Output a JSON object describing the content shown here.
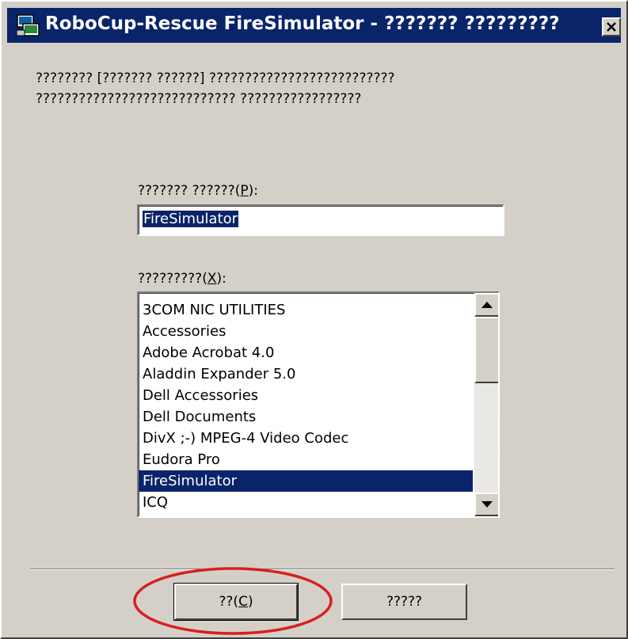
{
  "window": {
    "title": "RoboCup-Rescue FireSimulator - ??????? ?????????",
    "app_icon": "program-group-icon",
    "close_icon": "close-icon"
  },
  "description": {
    "line1": "???????? [??????? ??????] ??????????????????????????",
    "line2": "???????????????????????????? ?????????????????"
  },
  "program_name": {
    "label": "??????? ??????(",
    "label_mnemonic": "P",
    "label_suffix": "):",
    "value": "FireSimulator"
  },
  "folder": {
    "label": "?????????(",
    "label_mnemonic": "X",
    "label_suffix": "):",
    "items": [
      "3COM NIC UTILITIES",
      "Accessories",
      "Adobe Acrobat 4.0",
      "Aladdin Expander 5.0",
      "Dell Accessories",
      "Dell Documents",
      "DivX ;-) MPEG-4 Video Codec",
      "Eudora Pro",
      "FireSimulator",
      "ICQ"
    ],
    "selected": "FireSimulator"
  },
  "buttons": {
    "ok_prefix": "??(",
    "ok_mnemonic": "C",
    "ok_suffix": ")",
    "cancel": "?????"
  },
  "colors": {
    "titlebar": "#0a246a",
    "dialog_face": "#d4d0c8",
    "selection": "#0a246a",
    "annotation_ring": "#d62020"
  }
}
